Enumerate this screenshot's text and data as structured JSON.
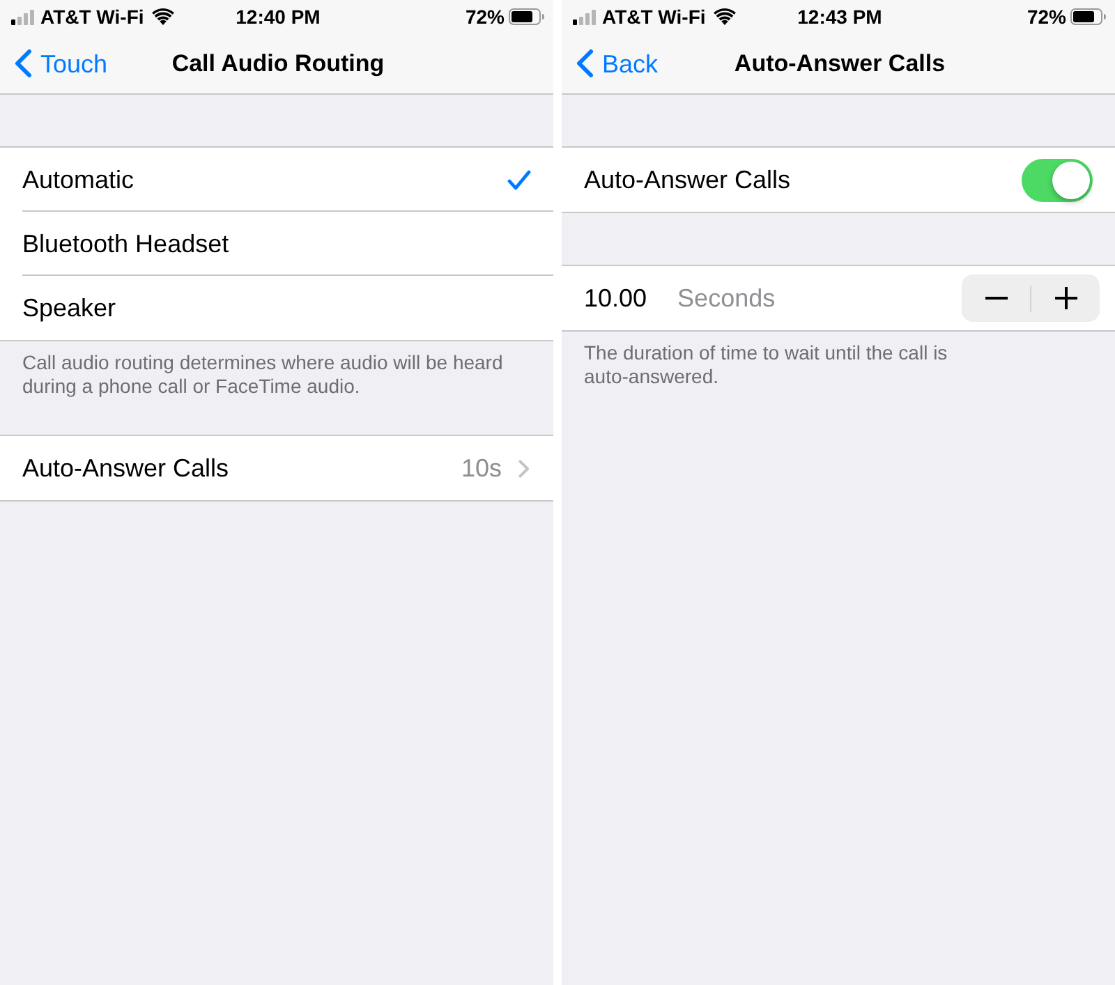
{
  "screens": [
    {
      "status_bar": {
        "carrier": "AT&T Wi-Fi",
        "time": "12:40 PM",
        "battery": "72%"
      },
      "nav_bar": {
        "back": "Touch",
        "title": "Call Audio Routing"
      },
      "sections": [
        {
          "rows": [
            {
              "kind": "option",
              "label": "Automatic",
              "selected": true
            },
            {
              "kind": "option",
              "label": "Bluetooth Headset",
              "selected": false
            },
            {
              "kind": "option",
              "label": "Speaker",
              "selected": false
            }
          ],
          "footer": "Call audio routing determines where audio will be heard\nduring a phone call or FaceTime audio."
        },
        {
          "rows": [
            {
              "kind": "link",
              "label": "Auto-Answer Calls",
              "value": "10s"
            }
          ]
        }
      ]
    },
    {
      "status_bar": {
        "carrier": "AT&T Wi-Fi",
        "time": "12:43 PM",
        "battery": "72%"
      },
      "nav_bar": {
        "back": "Back",
        "title": "Auto-Answer Calls"
      },
      "sections": [
        {
          "rows": [
            {
              "kind": "switch",
              "label": "Auto-Answer Calls",
              "on": true
            }
          ]
        },
        {
          "rows": [
            {
              "kind": "stepper",
              "value": "10.00",
              "unit": "Seconds"
            }
          ],
          "footer": "The duration of time to wait until the call is\nauto-answered."
        }
      ]
    }
  ]
}
